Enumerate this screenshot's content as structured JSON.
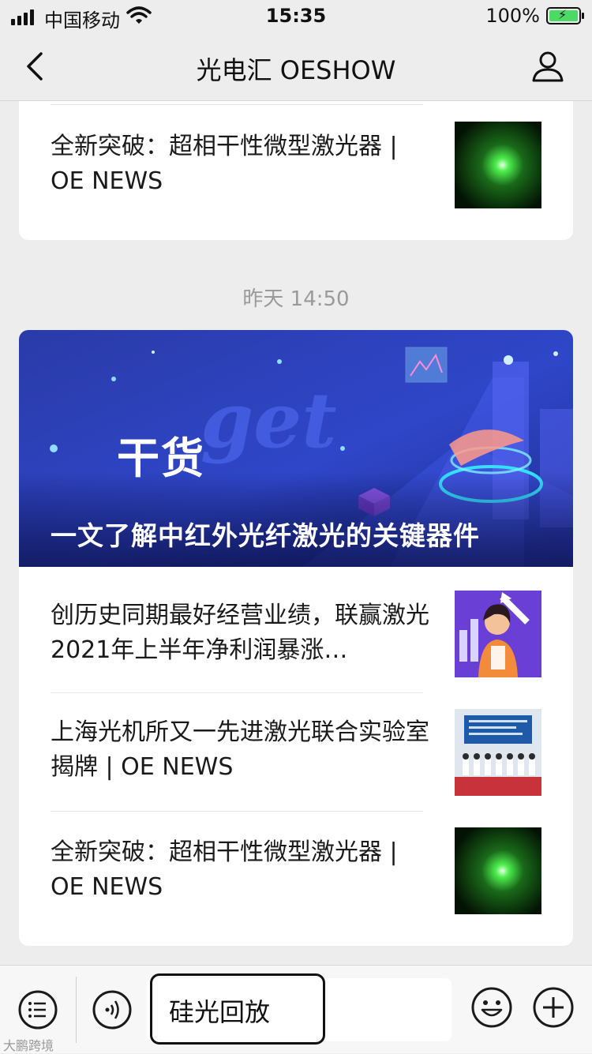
{
  "status": {
    "carrier": "中国移动",
    "time": "15:35",
    "battery": "100%"
  },
  "header": {
    "title": "光电汇 OESHOW"
  },
  "feed": {
    "previous_article": {
      "title": "全新突破：超相干性微型激光器 | OE NEWS"
    },
    "timestamp": "昨天 14:50",
    "cover": {
      "tag": "干货",
      "headline": "一文了解中红外光纤激光的关键器件"
    },
    "articles": [
      {
        "title": "创历史同期最好经营业绩，联赢激光 2021年上半年净利润暴涨…"
      },
      {
        "title": "上海光机所又一先进激光联合实验室揭牌 | OE NEWS"
      },
      {
        "title": "全新突破：超相干性微型激光器 | OE NEWS"
      }
    ]
  },
  "bottom_bar": {
    "input_text": "硅光回放",
    "watermark": "大鹏跨境"
  },
  "colors": {
    "background": "#ededed",
    "card": "#ffffff",
    "cover_blue": "#2b3fb8",
    "battery_green": "#4cd964"
  },
  "icons": [
    "signal-icon",
    "wifi-icon",
    "battery-icon",
    "back-icon",
    "profile-icon",
    "menu-icon",
    "voice-icon",
    "emoji-icon",
    "plus-icon"
  ]
}
